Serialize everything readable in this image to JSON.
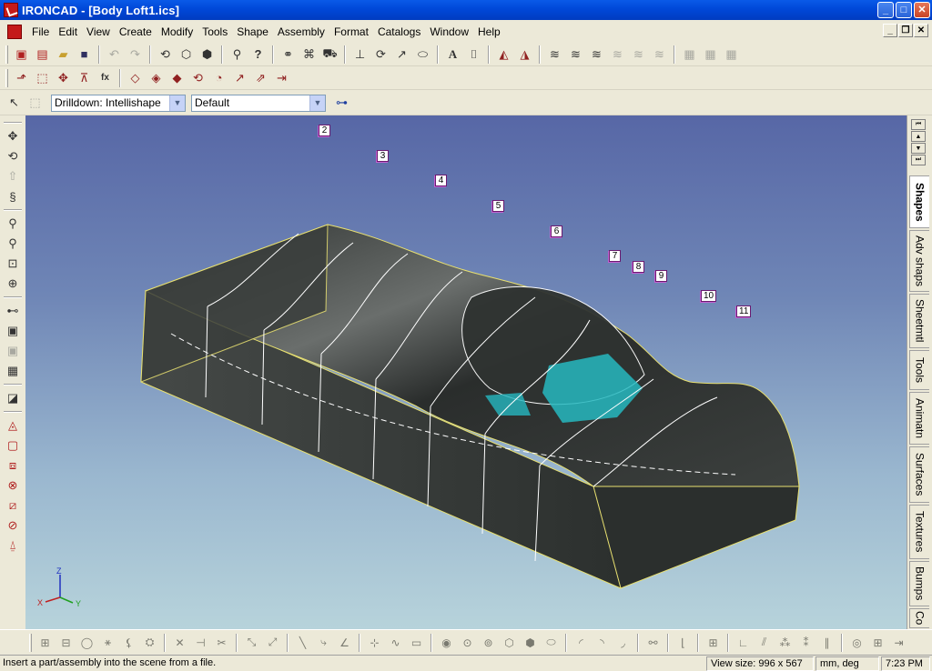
{
  "window": {
    "app_name": "IRONCAD",
    "title": "IRONCAD - [Body Loft1.ics]",
    "min_label": "_",
    "max_label": "□",
    "close_label": "✕",
    "mdi_min_label": "_",
    "mdi_restore_label": "❐",
    "mdi_close_label": "✕"
  },
  "menu": {
    "items": [
      {
        "label": "File"
      },
      {
        "label": "Edit"
      },
      {
        "label": "View"
      },
      {
        "label": "Create"
      },
      {
        "label": "Modify"
      },
      {
        "label": "Tools"
      },
      {
        "label": "Shape"
      },
      {
        "label": "Assembly"
      },
      {
        "label": "Format"
      },
      {
        "label": "Catalogs"
      },
      {
        "label": "Window"
      },
      {
        "label": "Help"
      }
    ]
  },
  "toolbar3": {
    "drilldown_value": "Drilldown: Intellishape",
    "style_value": "Default",
    "dropdown_arrow": "▼"
  },
  "viewport": {
    "colors": {
      "solid_fill": "#3a3e3c",
      "edge_yellow": "#e8e070",
      "wire_white": "#ffffff",
      "highlight_cyan": "#26b8c0",
      "tag_border": "#6a1a70"
    },
    "tags": [
      "2",
      "3",
      "4",
      "5",
      "6",
      "7",
      "8",
      "9",
      "10",
      "11"
    ],
    "axis": {
      "z": "Z",
      "x": "X",
      "y": "Y"
    }
  },
  "right_tabs": {
    "items": [
      {
        "label": "Shapes",
        "active": true
      },
      {
        "label": "Adv shaps"
      },
      {
        "label": "Sheetmtl"
      },
      {
        "label": "Tools"
      },
      {
        "label": "Animatn"
      },
      {
        "label": "Surfaces"
      },
      {
        "label": "Textures"
      },
      {
        "label": "Bumps"
      },
      {
        "label": "Co"
      }
    ]
  },
  "status": {
    "message": "Insert a part/assembly into the scene from a file.",
    "view_size": "View size:  996 x  567",
    "units": "mm, deg",
    "time": "7:23 PM"
  }
}
